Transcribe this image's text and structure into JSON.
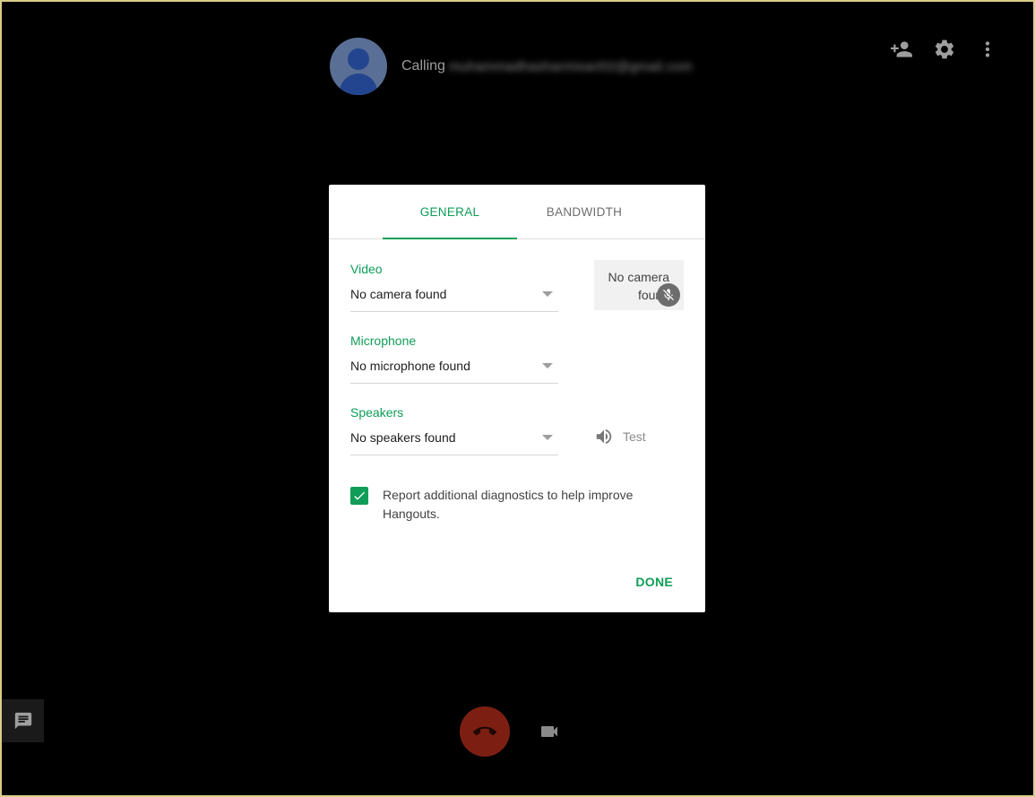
{
  "call": {
    "calling_label": "Calling",
    "calling_target": "muhammadhasharmisari02@gmail.com"
  },
  "top_actions": {
    "add_person_icon": "person-add-icon",
    "settings_icon": "gear-icon",
    "more_icon": "more-vert-icon"
  },
  "dialog": {
    "tabs": [
      {
        "label": "GENERAL",
        "active": true
      },
      {
        "label": "BANDWIDTH",
        "active": false
      }
    ],
    "video": {
      "label": "Video",
      "value": "No camera found"
    },
    "microphone": {
      "label": "Microphone",
      "value": "No microphone found"
    },
    "speakers": {
      "label": "Speakers",
      "value": "No speakers found"
    },
    "camera_preview": {
      "line1": "No camera",
      "line2": "found"
    },
    "test_label": "Test",
    "diagnostics": {
      "checked": true,
      "text": "Report additional diagnostics to help improve Hangouts."
    },
    "done_label": "DONE"
  },
  "bottom": {
    "chat_icon": "chat-icon",
    "hangup_icon": "hangup-icon",
    "video_icon": "videocam-icon"
  },
  "colors": {
    "accent": "#0f9d58",
    "hangup": "#7c1f12",
    "background": "#000000"
  }
}
